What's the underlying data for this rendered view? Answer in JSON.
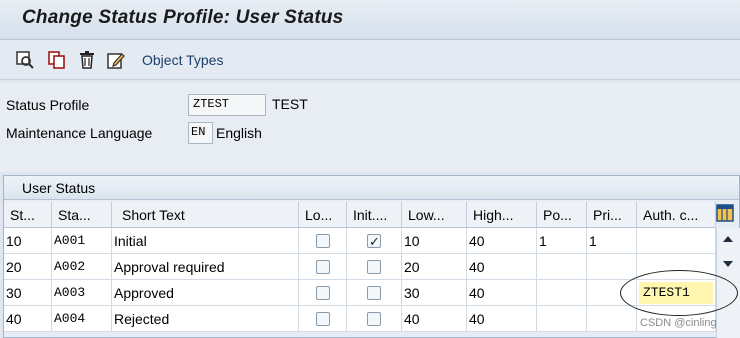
{
  "window": {
    "title": "Change Status Profile: User Status"
  },
  "toolbar": {
    "object_types_label": "Object Types"
  },
  "form": {
    "status_profile_label": "Status Profile",
    "status_profile_value": "ZTEST",
    "status_profile_desc": "TEST",
    "maint_lang_label": "Maintenance Language",
    "maint_lang_value": "EN",
    "maint_lang_desc": "English"
  },
  "table": {
    "title": "User Status",
    "headers": [
      "St...",
      "Sta...",
      "Short Text",
      "Lo...",
      "Init....",
      "Low...",
      "High...",
      "Po...",
      "Pri...",
      "Auth. c..."
    ],
    "rows": [
      {
        "st": "10",
        "sta": "A001",
        "text": "Initial",
        "lo": false,
        "init": true,
        "low": "10",
        "high": "40",
        "po": "1",
        "pri": "1",
        "auth": ""
      },
      {
        "st": "20",
        "sta": "A002",
        "text": "Approval required",
        "lo": false,
        "init": false,
        "low": "20",
        "high": "40",
        "po": "",
        "pri": "",
        "auth": ""
      },
      {
        "st": "30",
        "sta": "A003",
        "text": "Approved",
        "lo": false,
        "init": false,
        "low": "30",
        "high": "40",
        "po": "",
        "pri": "",
        "auth": "ZTEST1"
      },
      {
        "st": "40",
        "sta": "A004",
        "text": "Rejected",
        "lo": false,
        "init": false,
        "low": "40",
        "high": "40",
        "po": "",
        "pri": "",
        "auth": ""
      }
    ]
  },
  "watermark": "CSDN @cinling",
  "colors": {
    "accent": "#1d3e6e",
    "highlight": "#fff6b0",
    "background": "#dfe6ef"
  },
  "icons": [
    "display-change-icon",
    "copy-icon",
    "delete-icon",
    "edit-icon",
    "column-settings-icon",
    "scroll-up-icon",
    "scroll-down-icon"
  ]
}
